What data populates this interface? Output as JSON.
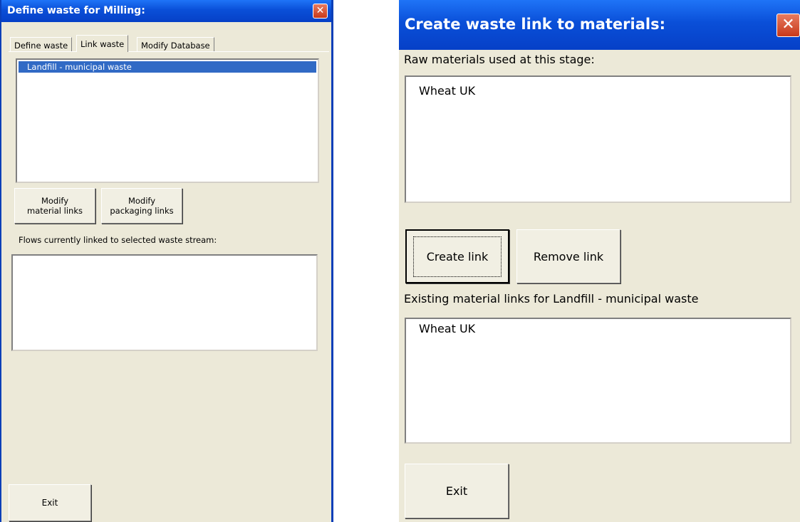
{
  "left_dialog": {
    "title": "Define waste for Milling:",
    "tabs": [
      "Define waste",
      "Link waste",
      "Modify Database"
    ],
    "waste_list": [
      "Landfill - municipal waste"
    ],
    "modify_material_button": "Modify material links",
    "modify_packaging_button": "Modify packaging links",
    "flows_label": "Flows currently linked to selected waste stream:",
    "exit_button": "Exit"
  },
  "right_dialog": {
    "title": "Create waste link to materials:",
    "raw_label": "Raw materials used at this stage:",
    "raw_items": [
      "Wheat UK"
    ],
    "create_button": "Create link",
    "remove_button": "Remove link",
    "existing_label": "Existing material links for Landfill - municipal waste",
    "existing_items": [
      "Wheat UK"
    ],
    "exit_button": "Exit"
  }
}
